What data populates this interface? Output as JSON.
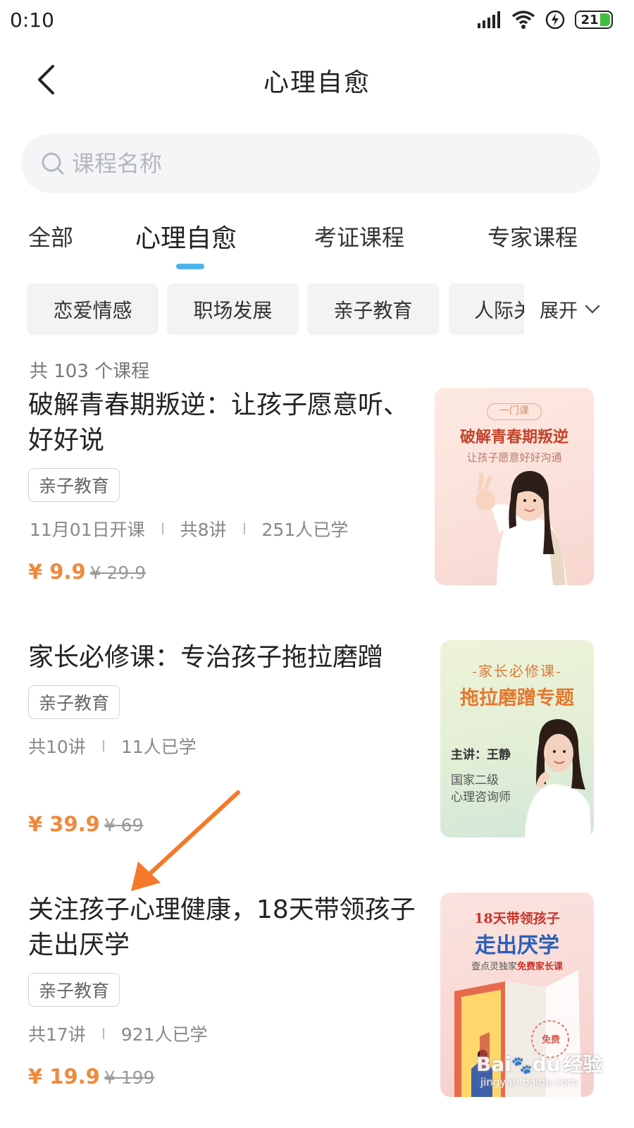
{
  "status": {
    "time": "0:10",
    "battery": "21"
  },
  "header": {
    "title": "心理自愈"
  },
  "search": {
    "placeholder": "课程名称"
  },
  "tabs": [
    {
      "label": "全部"
    },
    {
      "label": "心理自愈"
    },
    {
      "label": "考证课程"
    },
    {
      "label": "专家课程"
    }
  ],
  "categories": [
    "恋爱情感",
    "职场发展",
    "亲子教育",
    "人际关"
  ],
  "expand_label": "展开",
  "count_text": "共 103 个课程",
  "courses": [
    {
      "title": "破解青春期叛逆：让孩子愿意听、好好说",
      "tag": "亲子教育",
      "meta": [
        "11月01日开课",
        "共8讲",
        "251人已学"
      ],
      "price": "¥ 9.9",
      "original_price": "¥ 29.9",
      "cover": {
        "badge": "一门课",
        "headline": "破解青春期叛逆",
        "sub": "让孩子愿意好好沟通"
      }
    },
    {
      "title": "家长必修课：专治孩子拖拉磨蹭",
      "tag": "亲子教育",
      "meta": [
        "共10讲",
        "11人已学"
      ],
      "price": "¥ 39.9",
      "original_price": "¥ 69",
      "cover": {
        "top": "-家长必修课-",
        "headline": "拖拉磨蹭专题",
        "host": "主讲：王静",
        "role1": "国家二级",
        "role2": "心理咨询师"
      }
    },
    {
      "title": "关注孩子心理健康，18天带领孩子走出厌学",
      "tag": "亲子教育",
      "meta": [
        "共17讲",
        "921人已学"
      ],
      "price": "¥ 19.9",
      "original_price": "¥ 199",
      "cover": {
        "line1": "18天带领孩子",
        "headline": "走出厌学",
        "sub_a": "壹点灵独家",
        "sub_b": "免费家长课",
        "stamp": "免费"
      }
    }
  ],
  "watermark": {
    "logo": "Bai",
    "logo2": "du",
    "text": "经验",
    "url": "jingyan.baidu.com"
  },
  "colors": {
    "accent": "#4fb3ea",
    "price": "#f0893b",
    "annotation_arrow": "#f47a2a"
  }
}
